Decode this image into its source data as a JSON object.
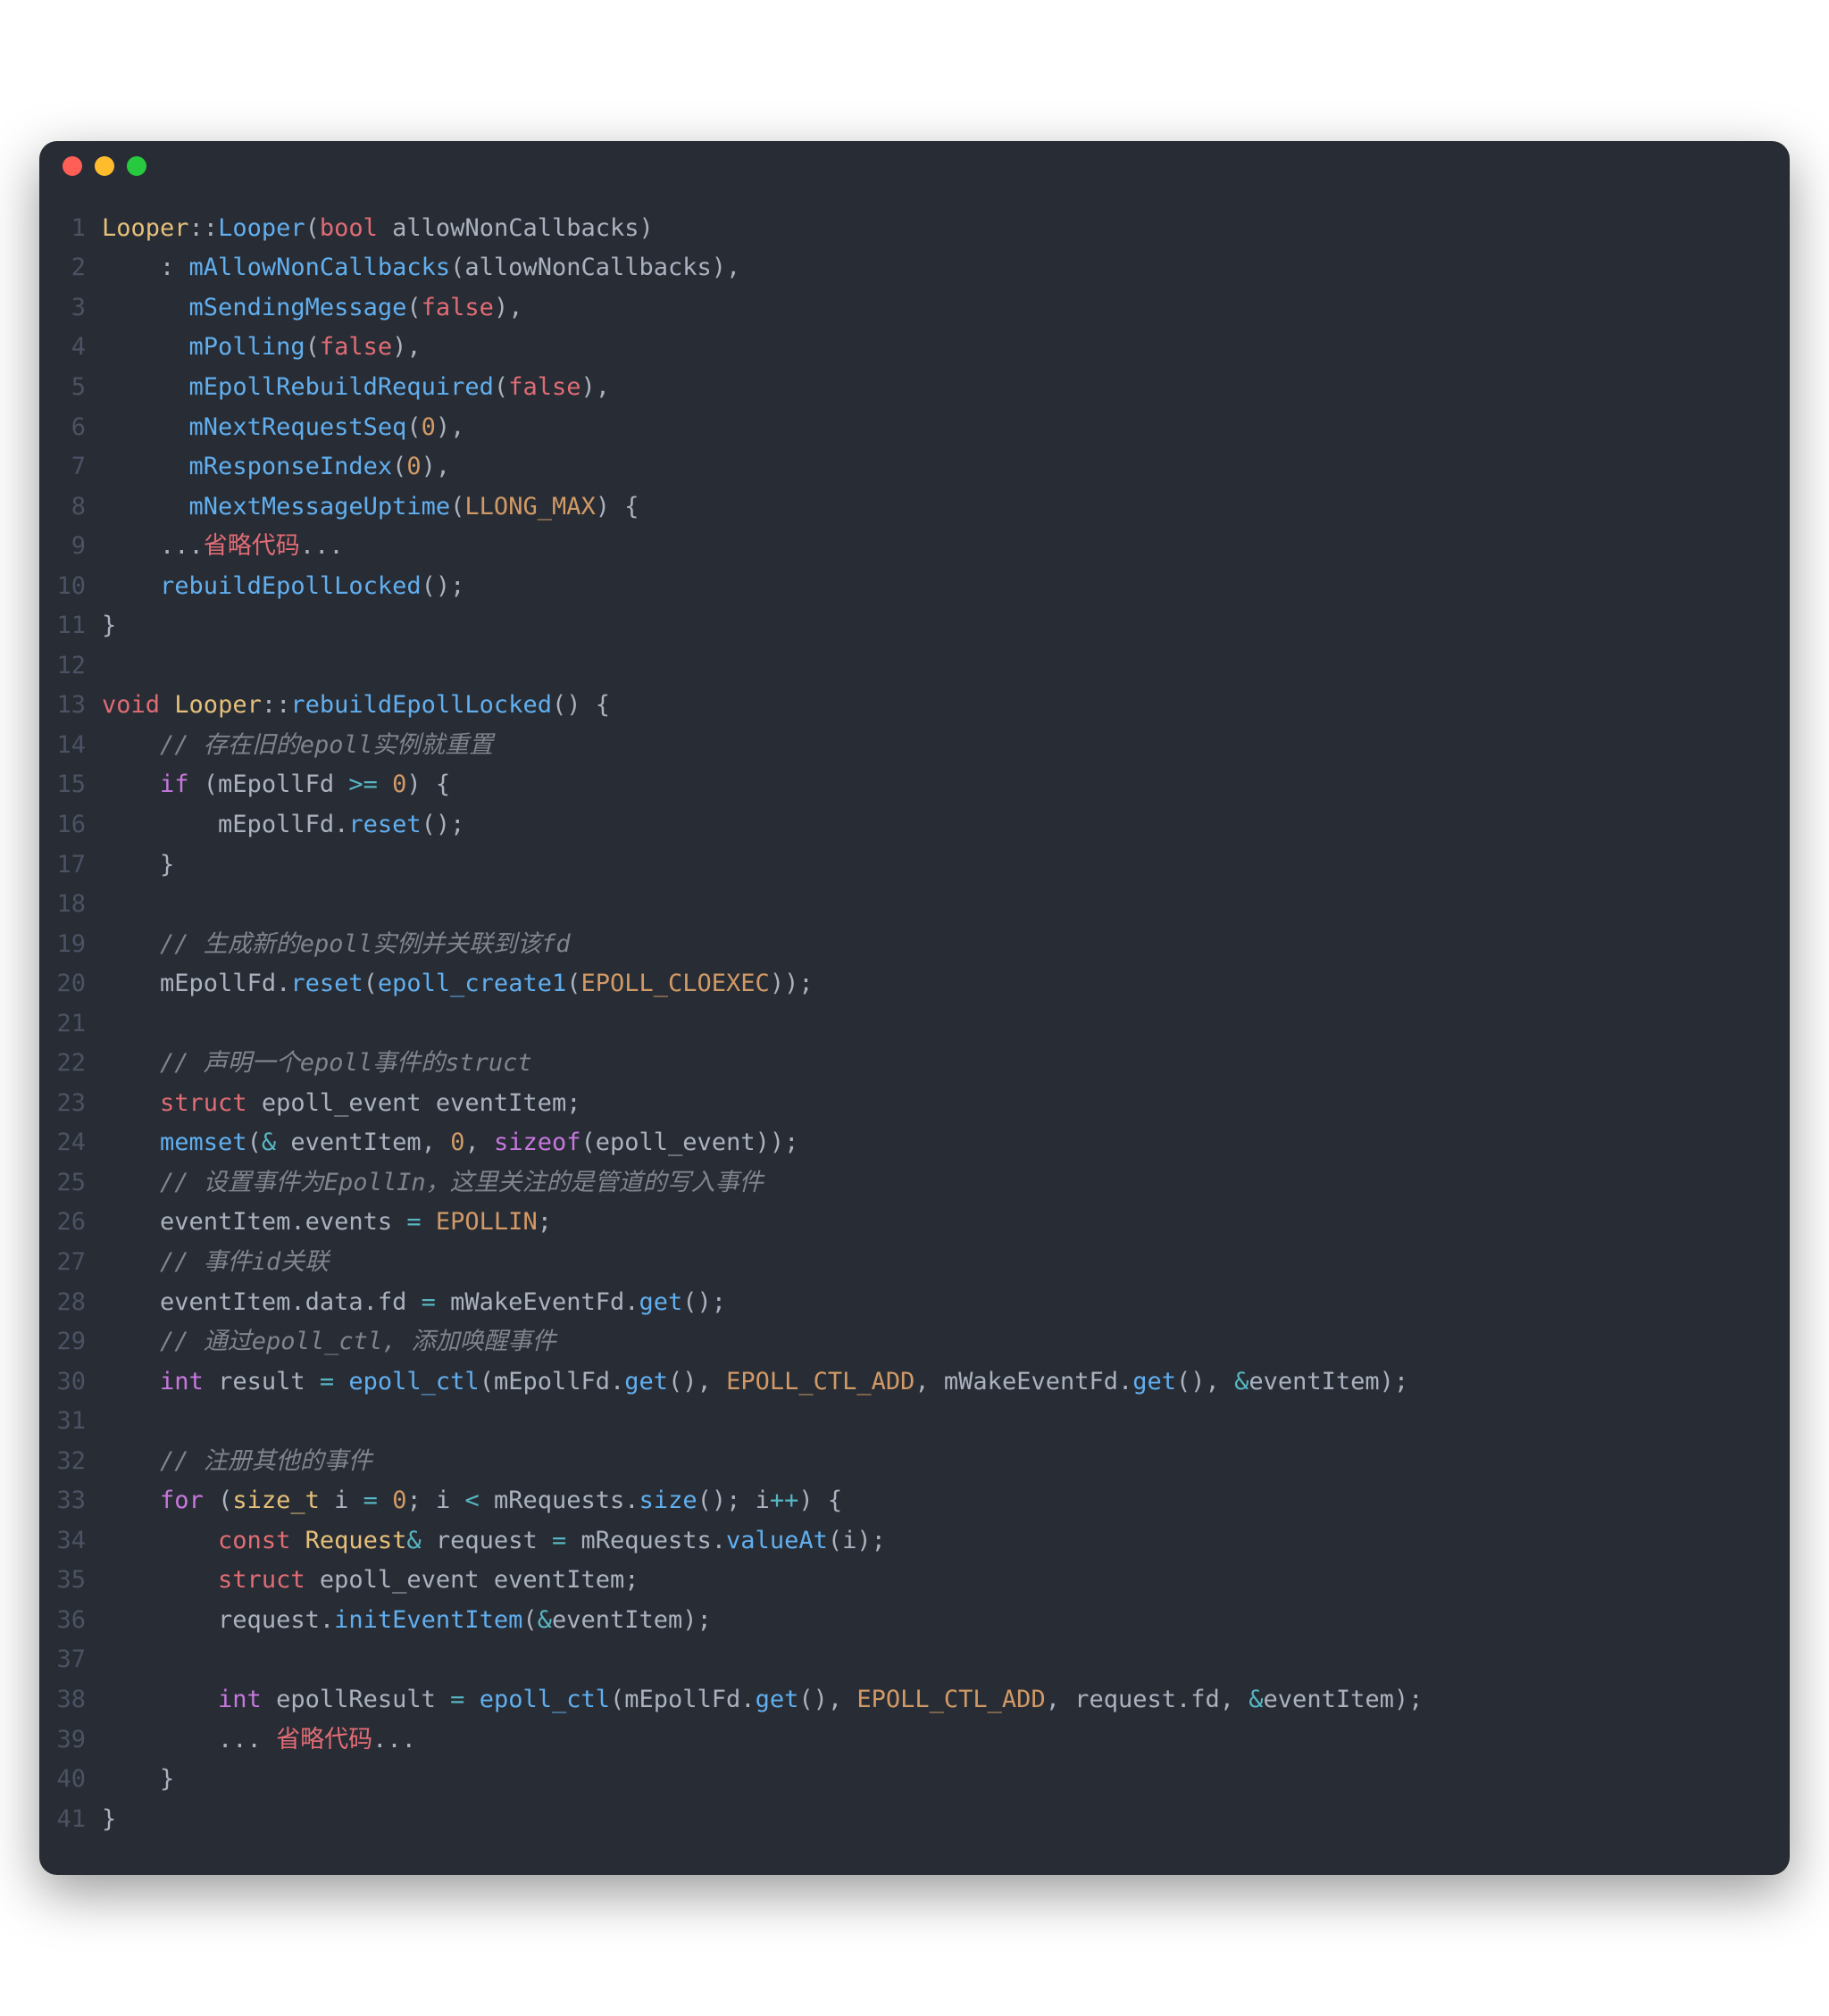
{
  "window": {
    "traffic_lights": [
      "close",
      "minimize",
      "zoom"
    ]
  },
  "code": {
    "lines": [
      {
        "n": 1,
        "html": "<span class='tok-yellow'>Looper</span><span class='tok-white'>::</span><span class='tok-blue'>Looper</span><span class='tok-white'>(</span><span class='tok-red'>bool</span><span class='tok-white'> allowNonCallbacks)</span>"
      },
      {
        "n": 2,
        "html": "<span class='tok-white'>    : </span><span class='tok-blue'>mAllowNonCallbacks</span><span class='tok-white'>(allowNonCallbacks),</span>"
      },
      {
        "n": 3,
        "html": "<span class='tok-white'>      </span><span class='tok-blue'>mSendingMessage</span><span class='tok-white'>(</span><span class='tok-red'>false</span><span class='tok-white'>),</span>"
      },
      {
        "n": 4,
        "html": "<span class='tok-white'>      </span><span class='tok-blue'>mPolling</span><span class='tok-white'>(</span><span class='tok-red'>false</span><span class='tok-white'>),</span>"
      },
      {
        "n": 5,
        "html": "<span class='tok-white'>      </span><span class='tok-blue'>mEpollRebuildRequired</span><span class='tok-white'>(</span><span class='tok-red'>false</span><span class='tok-white'>),</span>"
      },
      {
        "n": 6,
        "html": "<span class='tok-white'>      </span><span class='tok-blue'>mNextRequestSeq</span><span class='tok-white'>(</span><span class='tok-orange'>0</span><span class='tok-white'>),</span>"
      },
      {
        "n": 7,
        "html": "<span class='tok-white'>      </span><span class='tok-blue'>mResponseIndex</span><span class='tok-white'>(</span><span class='tok-orange'>0</span><span class='tok-white'>),</span>"
      },
      {
        "n": 8,
        "html": "<span class='tok-white'>      </span><span class='tok-blue'>mNextMessageUptime</span><span class='tok-white'>(</span><span class='tok-orange'>LLONG_MAX</span><span class='tok-white'>) {</span>"
      },
      {
        "n": 9,
        "html": "<span class='tok-white'>    ...</span><span class='tok-red'>省略代码</span><span class='tok-white'>...</span>"
      },
      {
        "n": 10,
        "html": "<span class='tok-white'>    </span><span class='tok-blue'>rebuildEpollLocked</span><span class='tok-white'>();</span>"
      },
      {
        "n": 11,
        "html": "<span class='tok-white'>}</span>"
      },
      {
        "n": 12,
        "html": ""
      },
      {
        "n": 13,
        "html": "<span class='tok-red'>void</span><span class='tok-white'> </span><span class='tok-yellow'>Looper</span><span class='tok-white'>::</span><span class='tok-blue'>rebuildEpollLocked</span><span class='tok-white'>() {</span>"
      },
      {
        "n": 14,
        "html": "<span class='tok-white'>    </span><span class='tok-comment'>// 存在旧的epoll实例就重置</span>"
      },
      {
        "n": 15,
        "html": "<span class='tok-white'>    </span><span class='tok-purple'>if</span><span class='tok-white'> (mEpollFd </span><span class='tok-op'>&gt;=</span><span class='tok-white'> </span><span class='tok-orange'>0</span><span class='tok-white'>) {</span>"
      },
      {
        "n": 16,
        "html": "<span class='tok-white'>        mEpollFd.</span><span class='tok-blue'>reset</span><span class='tok-white'>();</span>"
      },
      {
        "n": 17,
        "html": "<span class='tok-white'>    }</span>"
      },
      {
        "n": 18,
        "html": ""
      },
      {
        "n": 19,
        "html": "<span class='tok-white'>    </span><span class='tok-comment'>// 生成新的epoll实例并关联到该fd</span>"
      },
      {
        "n": 20,
        "html": "<span class='tok-white'>    mEpollFd.</span><span class='tok-blue'>reset</span><span class='tok-white'>(</span><span class='tok-blue'>epoll_create1</span><span class='tok-white'>(</span><span class='tok-orange'>EPOLL_CLOEXEC</span><span class='tok-white'>));</span>"
      },
      {
        "n": 21,
        "html": ""
      },
      {
        "n": 22,
        "html": "<span class='tok-white'>    </span><span class='tok-comment'>// 声明一个epoll事件的struct</span>"
      },
      {
        "n": 23,
        "html": "<span class='tok-white'>    </span><span class='tok-red'>struct</span><span class='tok-white'> epoll_event eventItem;</span>"
      },
      {
        "n": 24,
        "html": "<span class='tok-white'>    </span><span class='tok-blue'>memset</span><span class='tok-white'>(</span><span class='tok-op'>&amp;</span><span class='tok-white'> eventItem, </span><span class='tok-orange'>0</span><span class='tok-white'>, </span><span class='tok-purple'>sizeof</span><span class='tok-white'>(epoll_event));</span>"
      },
      {
        "n": 25,
        "html": "<span class='tok-white'>    </span><span class='tok-comment'>// 设置事件为EpollIn，这里关注的是管道的写入事件</span>"
      },
      {
        "n": 26,
        "html": "<span class='tok-white'>    eventItem.events </span><span class='tok-op'>=</span><span class='tok-white'> </span><span class='tok-orange'>EPOLLIN</span><span class='tok-white'>;</span>"
      },
      {
        "n": 27,
        "html": "<span class='tok-white'>    </span><span class='tok-comment'>// 事件id关联</span>"
      },
      {
        "n": 28,
        "html": "<span class='tok-white'>    eventItem.data.fd </span><span class='tok-op'>=</span><span class='tok-white'> mWakeEventFd.</span><span class='tok-blue'>get</span><span class='tok-white'>();</span>"
      },
      {
        "n": 29,
        "html": "<span class='tok-white'>    </span><span class='tok-comment'>// 通过epoll_ctl, 添加唤醒事件</span>"
      },
      {
        "n": 30,
        "html": "<span class='tok-white'>    </span><span class='tok-purple'>int</span><span class='tok-white'> result </span><span class='tok-op'>=</span><span class='tok-white'> </span><span class='tok-blue'>epoll_ctl</span><span class='tok-white'>(mEpollFd.</span><span class='tok-blue'>get</span><span class='tok-white'>(), </span><span class='tok-orange'>EPOLL_CTL_ADD</span><span class='tok-white'>, mWakeEventFd.</span><span class='tok-blue'>get</span><span class='tok-white'>(), </span><span class='tok-op'>&amp;</span><span class='tok-white'>eventItem);</span>"
      },
      {
        "n": 31,
        "html": ""
      },
      {
        "n": 32,
        "html": "<span class='tok-white'>    </span><span class='tok-comment'>// 注册其他的事件</span>"
      },
      {
        "n": 33,
        "html": "<span class='tok-white'>    </span><span class='tok-purple'>for</span><span class='tok-white'> (</span><span class='tok-yellow'>size_t</span><span class='tok-white'> i </span><span class='tok-op'>=</span><span class='tok-white'> </span><span class='tok-orange'>0</span><span class='tok-white'>; i </span><span class='tok-op'>&lt;</span><span class='tok-white'> mRequests.</span><span class='tok-blue'>size</span><span class='tok-white'>(); i</span><span class='tok-op'>++</span><span class='tok-white'>) {</span>"
      },
      {
        "n": 34,
        "html": "<span class='tok-white'>        </span><span class='tok-red'>const</span><span class='tok-white'> </span><span class='tok-yellow'>Request</span><span class='tok-op'>&amp;</span><span class='tok-white'> request </span><span class='tok-op'>=</span><span class='tok-white'> mRequests.</span><span class='tok-blue'>valueAt</span><span class='tok-white'>(i);</span>"
      },
      {
        "n": 35,
        "html": "<span class='tok-white'>        </span><span class='tok-red'>struct</span><span class='tok-white'> epoll_event eventItem;</span>"
      },
      {
        "n": 36,
        "html": "<span class='tok-white'>        request.</span><span class='tok-blue'>initEventItem</span><span class='tok-white'>(</span><span class='tok-op'>&amp;</span><span class='tok-white'>eventItem);</span>"
      },
      {
        "n": 37,
        "html": ""
      },
      {
        "n": 38,
        "html": "<span class='tok-white'>        </span><span class='tok-purple'>int</span><span class='tok-white'> epollResult </span><span class='tok-op'>=</span><span class='tok-white'> </span><span class='tok-blue'>epoll_ctl</span><span class='tok-white'>(mEpollFd.</span><span class='tok-blue'>get</span><span class='tok-white'>(), </span><span class='tok-orange'>EPOLL_CTL_ADD</span><span class='tok-white'>, request.fd, </span><span class='tok-op'>&amp;</span><span class='tok-white'>eventItem);</span>"
      },
      {
        "n": 39,
        "html": "<span class='tok-white'>        ... </span><span class='tok-red'>省略代码</span><span class='tok-white'>...</span>"
      },
      {
        "n": 40,
        "html": "<span class='tok-white'>    }</span>"
      },
      {
        "n": 41,
        "html": "<span class='tok-white'>}</span>"
      }
    ]
  }
}
